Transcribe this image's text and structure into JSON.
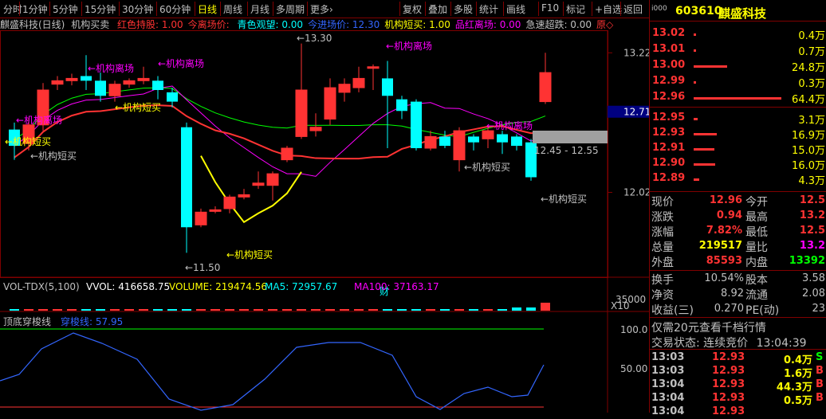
{
  "toolbar": {
    "periods": [
      "分时",
      "1分钟",
      "5分钟",
      "15分钟",
      "30分钟",
      "60分钟",
      "日线",
      "周线",
      "月线",
      "多周期",
      "更多›"
    ],
    "active_period": "日线",
    "actions": [
      "复权",
      "叠加",
      "多股",
      "统计",
      "画线",
      "F10",
      "标记",
      "+自选",
      "返回"
    ]
  },
  "indicator_line": {
    "title": "麒盛科技(日线)",
    "name": "机构买卖",
    "items": [
      {
        "label": "红色持股: 1.00",
        "color": "#ff3333"
      },
      {
        "label": "今离场价: ",
        "color": "#ff3333"
      },
      {
        "label": "青色观望: 0.00",
        "color": "#00ffff"
      },
      {
        "label": "今进场价: 12.30",
        "color": "#3366ff"
      },
      {
        "label": "机构短买: 1.00",
        "color": "#ffff00"
      },
      {
        "label": "品红离场: 0.00",
        "color": "#ff00ff"
      },
      {
        "label": "急速超跌: 0.00",
        "color": "#c0c0c0"
      },
      {
        "label": "原◇",
        "color": "#ff3333"
      }
    ]
  },
  "price_axis": {
    "labels": [
      "13.22",
      "12.71",
      "12.02"
    ],
    "current": "12.71"
  },
  "annotations": {
    "high": "13.30",
    "low": "11.50",
    "range_note": "12.45 - 12.55",
    "exit": "←机构离场",
    "short_buy": "←机构短买",
    "finance_marker": "财"
  },
  "volume_panel": {
    "name": "VOL-TDX(5,100)",
    "vvol": "VVOL: 416658.75",
    "volume": "VOLUME: 219474.56",
    "ma5": "MA5: 72957.67",
    "ma100": "MA100: 37163.17",
    "axis_label": "35000",
    "unit": "X10"
  },
  "osc_panel": {
    "name": "顶底穿梭线",
    "value": "穿梭线: 57.95",
    "axis": [
      "100.0",
      "50.00"
    ]
  },
  "quote": {
    "code": "603610",
    "name": "麒盛科技",
    "asks": [
      {
        "price": "13.02",
        "vol": "0.4万"
      },
      {
        "price": "13.01",
        "vol": "0.7万"
      },
      {
        "price": "13.00",
        "vol": "24.8万"
      },
      {
        "price": "12.99",
        "vol": "0.3万"
      },
      {
        "price": "12.96",
        "vol": "64.4万"
      }
    ],
    "bids": [
      {
        "price": "12.95",
        "vol": "3.1万"
      },
      {
        "price": "12.93",
        "vol": "16.9万"
      },
      {
        "price": "12.91",
        "vol": "15.0万"
      },
      {
        "price": "12.90",
        "vol": "16.0万"
      },
      {
        "price": "12.89",
        "vol": "4.3万"
      }
    ],
    "stats": [
      {
        "l1": "现价",
        "v1": "12.96",
        "c1": "#ff3333",
        "l2": "今开",
        "v2": "12.5",
        "c2": "#ff3333"
      },
      {
        "l1": "涨跌",
        "v1": "0.94",
        "c1": "#ff3333",
        "l2": "最高",
        "v2": "13.2",
        "c2": "#ff3333"
      },
      {
        "l1": "涨幅",
        "v1": "7.82%",
        "c1": "#ff3333",
        "l2": "最低",
        "v2": "12.5",
        "c2": "#ff3333"
      },
      {
        "l1": "总量",
        "v1": "219517",
        "c1": "#ffff00",
        "l2": "量比",
        "v2": "13.2",
        "c2": "#ff00ff"
      },
      {
        "l1": "外盘",
        "v1": "85593",
        "c1": "#ff3333",
        "l2": "内盘",
        "v2": "13392",
        "c2": "#00ff00"
      }
    ],
    "stats2": [
      {
        "l1": "换手",
        "v1": "10.54%",
        "l2": "股本",
        "v2": "3.58"
      },
      {
        "l1": "净资",
        "v1": "8.92",
        "l2": "流通",
        "v2": "2.08"
      },
      {
        "l1": "收益(三)",
        "v1": "0.270",
        "l2": "PE(动)",
        "v2": "23"
      }
    ],
    "promo": "仅需20元查看千档行情",
    "trade_state": "交易状态: 连续竞价",
    "trade_time": "13:04:39",
    "ticks": [
      {
        "time": "13:03",
        "price": "12.93",
        "vol": "0.4万",
        "side": "S"
      },
      {
        "time": "13:03",
        "price": "12.93",
        "vol": "1.6万",
        "side": "B"
      },
      {
        "time": "13:04",
        "price": "12.93",
        "vol": "44.3万",
        "side": "B"
      },
      {
        "time": "13:04",
        "price": "12.93",
        "vol": "0.5万",
        "side": "B"
      },
      {
        "time": "13:04",
        "price": "12.93",
        "vol": "",
        "side": ""
      }
    ]
  },
  "colors": {
    "up": "#ff3333",
    "down": "#00ffff",
    "border": "#800000",
    "yellow": "#ffff00",
    "magenta": "#ff00ff"
  },
  "chart_data": {
    "type": "candlestick",
    "ylim": [
      11.4,
      13.4
    ],
    "candles": [
      {
        "o": 12.56,
        "c": 12.42,
        "h": 12.62,
        "l": 12.3,
        "color": "cyan"
      },
      {
        "o": 12.44,
        "c": 12.6,
        "h": 12.66,
        "l": 12.38,
        "color": "red"
      },
      {
        "o": 12.6,
        "c": 12.9,
        "h": 12.96,
        "l": 12.55,
        "color": "red"
      },
      {
        "o": 12.95,
        "c": 12.98,
        "h": 13.02,
        "l": 12.9,
        "color": "red"
      },
      {
        "o": 12.98,
        "c": 13.0,
        "h": 13.04,
        "l": 12.94,
        "color": "red"
      },
      {
        "o": 13.02,
        "c": 12.98,
        "h": 13.2,
        "l": 12.9,
        "color": "cyan"
      },
      {
        "o": 12.98,
        "c": 12.85,
        "h": 13.05,
        "l": 12.8,
        "color": "cyan"
      },
      {
        "o": 12.85,
        "c": 12.95,
        "h": 12.98,
        "l": 12.8,
        "color": "red"
      },
      {
        "o": 12.95,
        "c": 12.98,
        "h": 13.0,
        "l": 12.92,
        "color": "red"
      },
      {
        "o": 12.98,
        "c": 13.0,
        "h": 13.1,
        "l": 12.95,
        "color": "red"
      },
      {
        "o": 12.98,
        "c": 12.9,
        "h": 13.02,
        "l": 12.82,
        "color": "cyan"
      },
      {
        "o": 12.88,
        "c": 12.8,
        "h": 12.92,
        "l": 12.75,
        "color": "cyan"
      },
      {
        "o": 12.58,
        "c": 11.72,
        "h": 12.62,
        "l": 11.5,
        "color": "cyan"
      },
      {
        "o": 11.74,
        "c": 11.85,
        "h": 11.88,
        "l": 11.72,
        "color": "red"
      },
      {
        "o": 11.86,
        "c": 11.87,
        "h": 11.9,
        "l": 11.84,
        "color": "red"
      },
      {
        "o": 11.88,
        "c": 11.98,
        "h": 12.0,
        "l": 11.84,
        "color": "red"
      },
      {
        "o": 11.98,
        "c": 12.0,
        "h": 12.05,
        "l": 11.96,
        "color": "red"
      },
      {
        "o": 12.08,
        "c": 12.1,
        "h": 12.2,
        "l": 12.05,
        "color": "red"
      },
      {
        "o": 12.08,
        "c": 12.18,
        "h": 12.2,
        "l": 11.95,
        "color": "red"
      },
      {
        "o": 12.3,
        "c": 12.4,
        "h": 12.42,
        "l": 12.28,
        "color": "red"
      },
      {
        "o": 12.5,
        "c": 12.9,
        "h": 13.3,
        "l": 12.48,
        "color": "red"
      },
      {
        "o": 12.55,
        "c": 12.58,
        "h": 12.7,
        "l": 12.5,
        "color": "red"
      },
      {
        "o": 12.65,
        "c": 12.92,
        "h": 13.0,
        "l": 12.6,
        "color": "red"
      },
      {
        "o": 12.88,
        "c": 12.95,
        "h": 13.0,
        "l": 12.8,
        "color": "red"
      },
      {
        "o": 12.92,
        "c": 13.0,
        "h": 13.1,
        "l": 12.88,
        "color": "red"
      },
      {
        "o": 13.1,
        "c": 13.1,
        "h": 13.12,
        "l": 12.9,
        "color": "red"
      },
      {
        "o": 13.0,
        "c": 12.85,
        "h": 13.15,
        "l": 12.4,
        "color": "cyan"
      },
      {
        "o": 12.82,
        "c": 12.72,
        "h": 12.85,
        "l": 12.65,
        "color": "cyan"
      },
      {
        "o": 12.8,
        "c": 12.4,
        "h": 12.82,
        "l": 12.38,
        "color": "cyan"
      },
      {
        "o": 12.4,
        "c": 12.5,
        "h": 12.55,
        "l": 12.38,
        "color": "red"
      },
      {
        "o": 12.5,
        "c": 12.42,
        "h": 12.55,
        "l": 12.4,
        "color": "cyan"
      },
      {
        "o": 12.3,
        "c": 12.55,
        "h": 12.58,
        "l": 12.2,
        "color": "red"
      },
      {
        "o": 12.5,
        "c": 12.45,
        "h": 12.52,
        "l": 12.38,
        "color": "cyan"
      },
      {
        "o": 12.48,
        "c": 12.55,
        "h": 12.58,
        "l": 12.4,
        "color": "red"
      },
      {
        "o": 12.52,
        "c": 12.45,
        "h": 12.55,
        "l": 12.35,
        "color": "cyan"
      },
      {
        "o": 12.5,
        "c": 12.42,
        "h": 12.52,
        "l": 12.38,
        "color": "cyan"
      },
      {
        "o": 12.45,
        "c": 12.15,
        "h": 12.48,
        "l": 12.12,
        "color": "cyan"
      },
      {
        "o": 12.8,
        "c": 13.05,
        "h": 13.22,
        "l": 12.78,
        "color": "red"
      }
    ]
  }
}
